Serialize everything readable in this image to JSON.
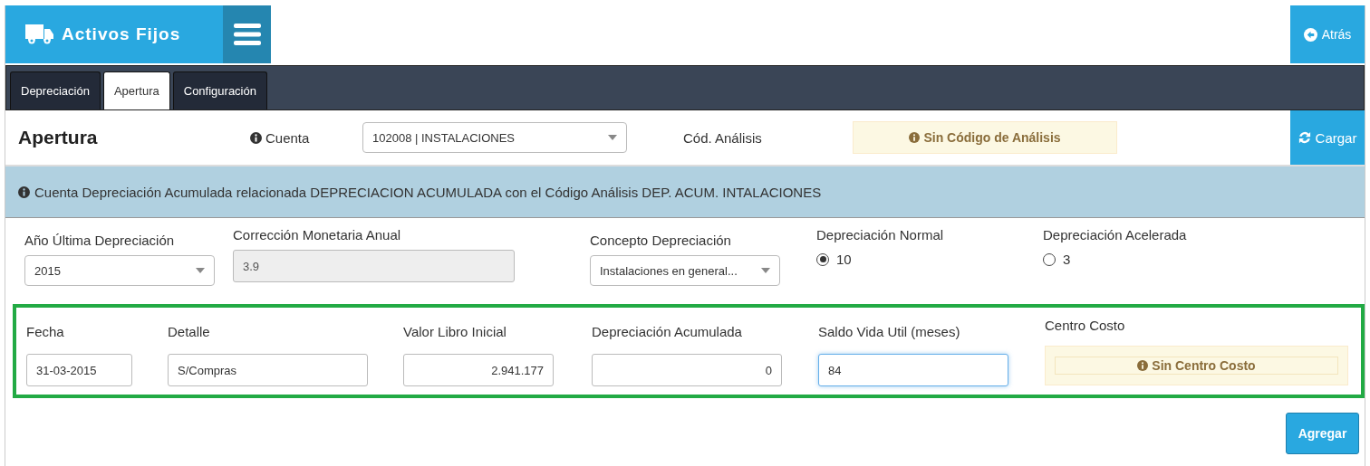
{
  "header": {
    "title": "Activos Fijos",
    "back_button": "Atrás"
  },
  "tabs": [
    {
      "label": "Depreciación",
      "selected": false
    },
    {
      "label": "Apertura",
      "selected": true
    },
    {
      "label": "Configuración",
      "selected": false
    }
  ],
  "toolbar": {
    "title": "Apertura",
    "account_label": "Cuenta",
    "account_value": "102008 | INSTALACIONES",
    "analysis_label": "Cód. Análisis",
    "analysis_alert": "Sin Código de Análisis",
    "load_button": "Cargar"
  },
  "info_message": "Cuenta Depreciación Acumulada relacionada DEPRECIACION ACUMULADA con el Código Análisis DEP. ACUM. INTALACIONES",
  "top_fields": [
    {
      "kind": "select",
      "label": "Año Última Depreciación",
      "value": "2015"
    },
    {
      "kind": "input",
      "label": "Corrección Monetaria Anual",
      "value": "3.9",
      "disabled": true
    },
    {
      "kind": "select",
      "label": "Concepto Depreciación",
      "value": "Instalaciones en general..."
    },
    {
      "kind": "radio",
      "label": "Depreciación Normal",
      "option": "10",
      "selected": true
    },
    {
      "kind": "radio",
      "label": "Depreciación Acelerada",
      "option": "3",
      "selected": false
    }
  ],
  "entry_fields": [
    {
      "kind": "text",
      "label": "Fecha",
      "value": "31-03-2015",
      "focused": false
    },
    {
      "kind": "text",
      "label": "Detalle",
      "value": "S/Compras",
      "focused": false
    },
    {
      "kind": "number",
      "label": "Valor Libro Inicial",
      "value": "2.941.177",
      "focused": false
    },
    {
      "kind": "number",
      "label": "Depreciación Acumulada",
      "value": "0",
      "focused": false
    },
    {
      "kind": "text",
      "label": "Saldo Vida Util (meses)",
      "value": "84",
      "focused": true
    },
    {
      "kind": "alert",
      "label": "Centro Costo",
      "value": "Sin Centro Costo"
    }
  ],
  "add_button": "Agregar"
}
